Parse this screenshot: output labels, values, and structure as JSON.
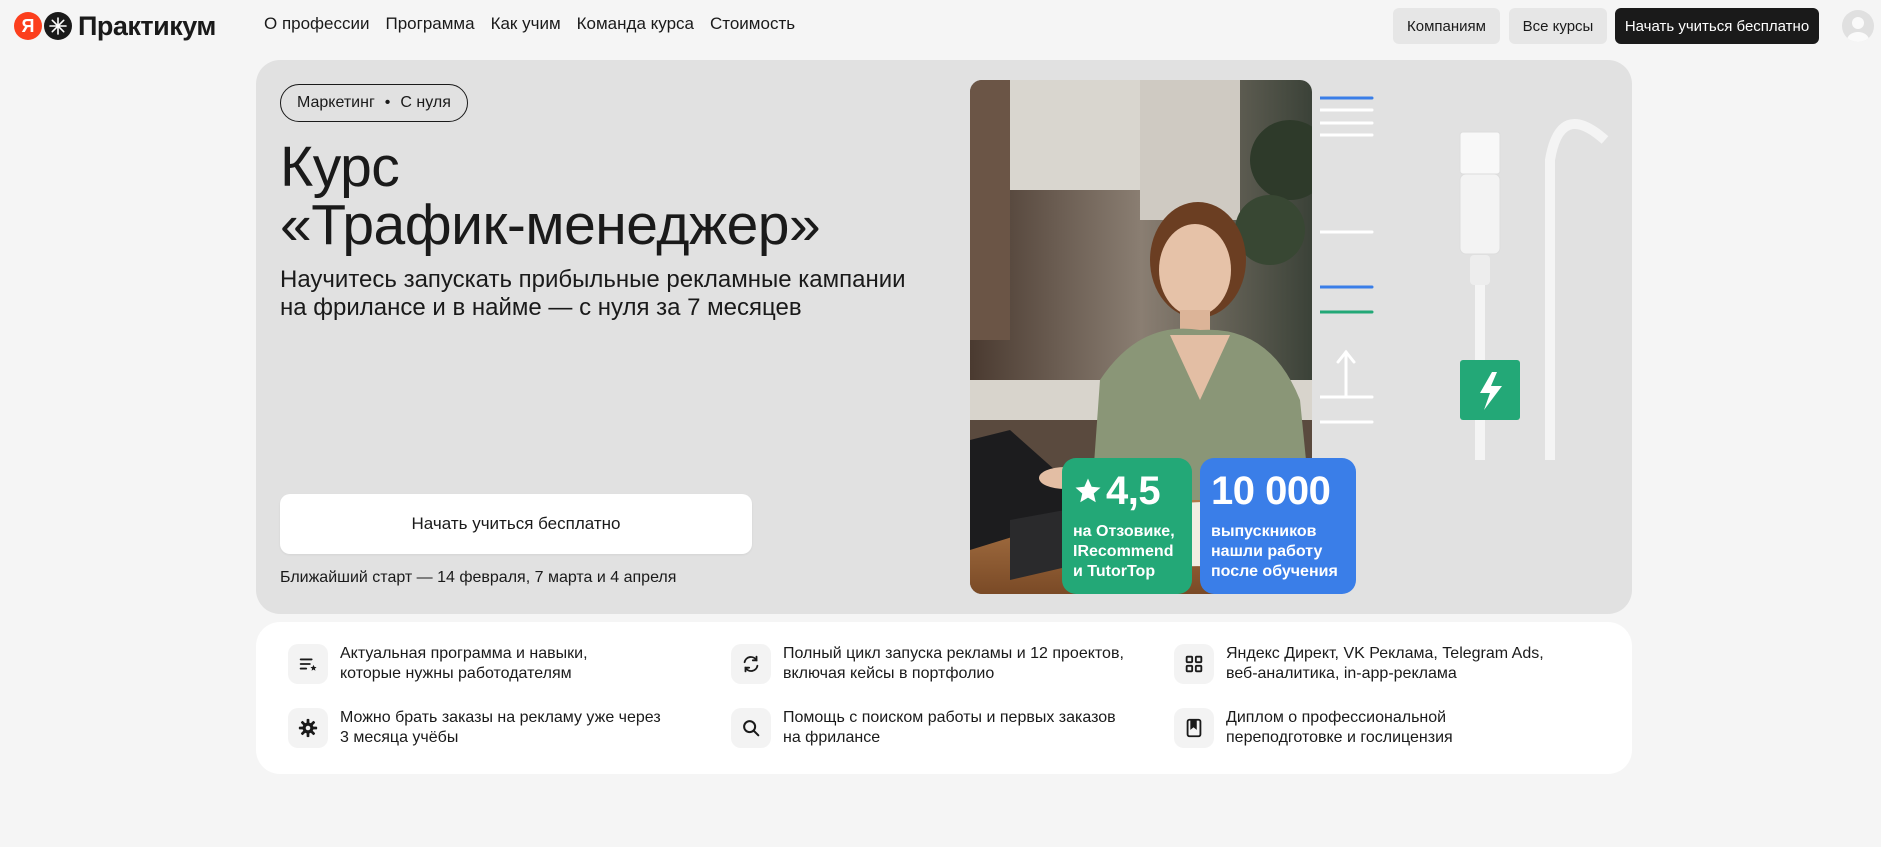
{
  "header": {
    "logo_ya": "Я",
    "logo_text": "Практикум",
    "nav": [
      "О профессии",
      "Программа",
      "Как учим",
      "Команда курса",
      "Стоимость"
    ],
    "btn_companies": "Компаниям",
    "btn_all_courses": "Все курсы",
    "btn_start": "Начать учиться бесплатно"
  },
  "hero": {
    "tag_left": "Маркетинг",
    "tag_sep": "•",
    "tag_right": "С нуля",
    "title_line1": "Курс",
    "title_line2": "«Трафик-менеджер»",
    "subtitle_line1": "Научитесь запускать прибыльные рекламные кампании",
    "subtitle_line2": "на фрилансе и в найме — с нуля за 7 месяцев",
    "cta": "Начать учиться бесплатно",
    "start_date": "Ближайший старт — 14 февраля, 7 марта и 4 апреля",
    "rating": {
      "value": "4,5",
      "line1": "на Отзовике,",
      "line2": "IRecommend",
      "line3": "и TutorTop",
      "color": "#23a877"
    },
    "graduates": {
      "value": "10 000",
      "line1": "выпускников",
      "line2": "нашли работу",
      "line3": "после обучения",
      "color": "#3a7ee8"
    }
  },
  "features": [
    {
      "icon": "list-star-icon",
      "line1": "Актуальная программа и навыки,",
      "line2": "которые нужны работодателям"
    },
    {
      "icon": "refresh-icon",
      "line1": "Полный цикл запуска рекламы и 12 проектов,",
      "line2": "включая кейсы в портфолио"
    },
    {
      "icon": "grid-icon",
      "line1": "Яндекс Директ, VK Реклама, Telegram Ads,",
      "line2": "веб-аналитика, in-app-реклама"
    },
    {
      "icon": "gear-icon",
      "line1": "Можно брать заказы на рекламу уже через",
      "line2": "3 месяца учёбы"
    },
    {
      "icon": "search-icon",
      "line1": "Помощь с поиском работы и первых заказов",
      "line2": "на фрилансе"
    },
    {
      "icon": "diploma-icon",
      "line1": "Диплом о профессиональной",
      "line2": "переподготовке и гослицензия"
    }
  ]
}
